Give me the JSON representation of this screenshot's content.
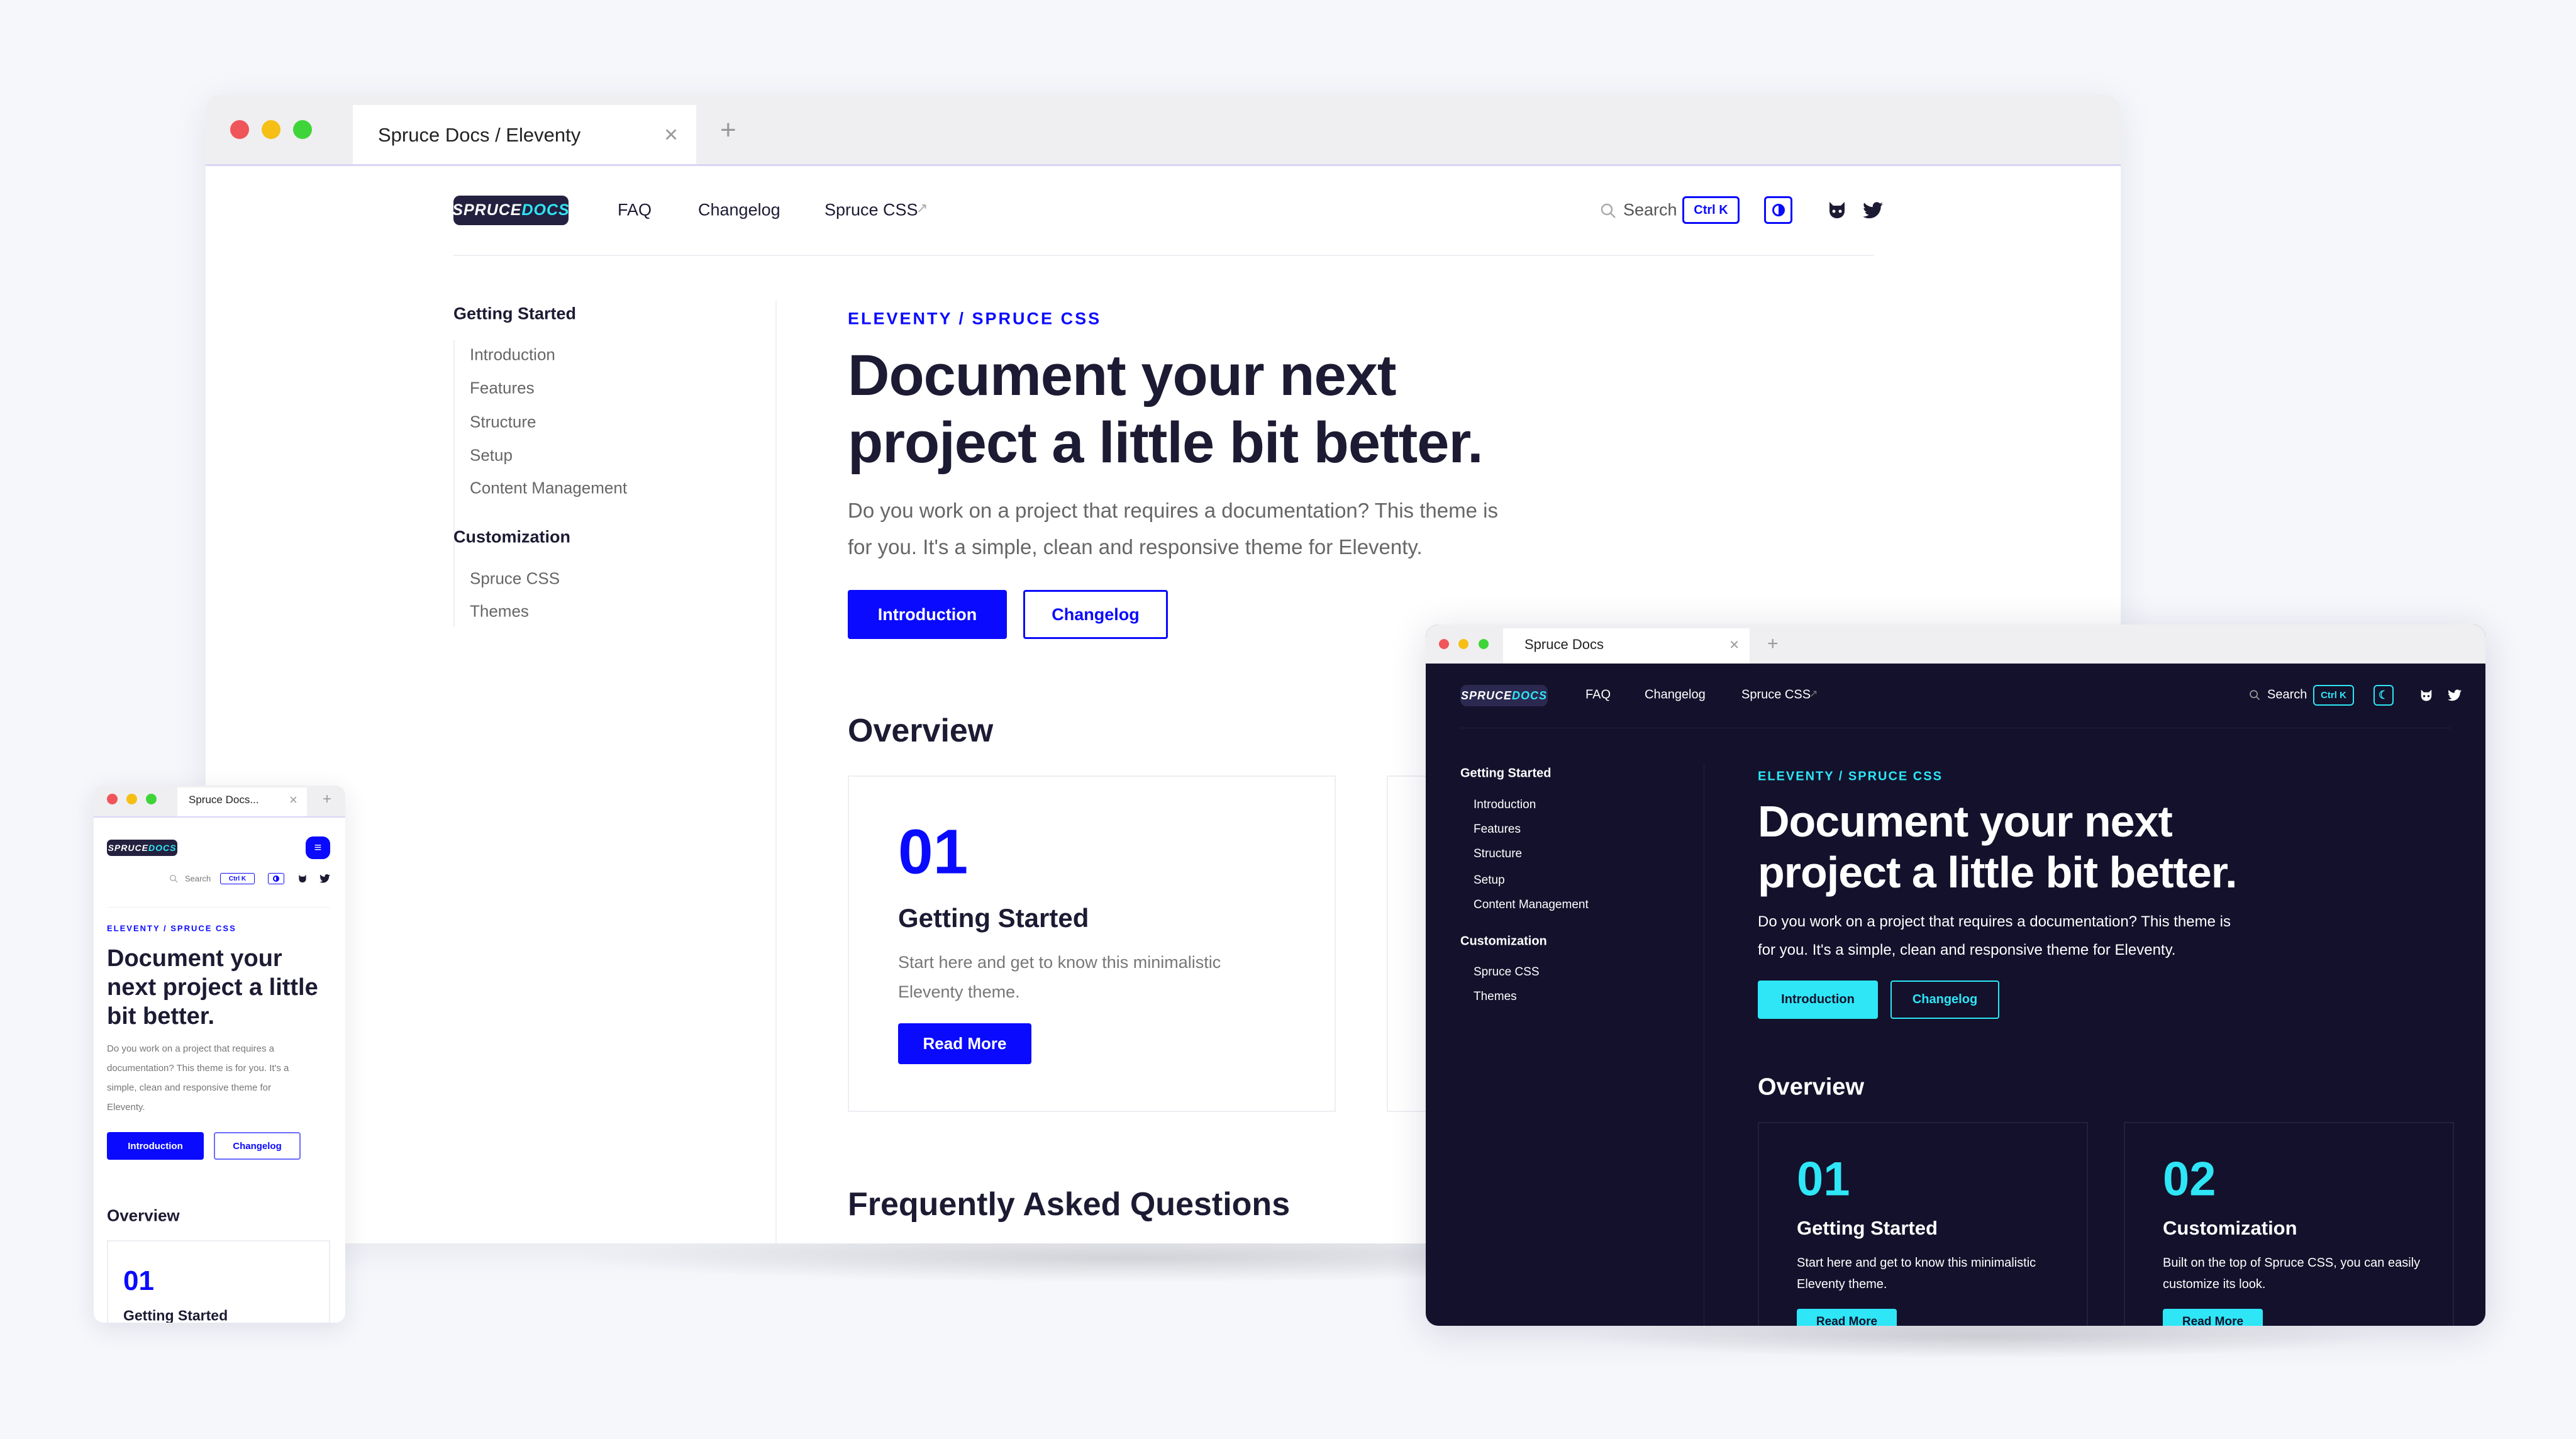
{
  "colors": {
    "accent_light": "#0a0aff",
    "accent_dark": "#2ee6f6",
    "dark_bg": "#13112b",
    "text": "#15142e"
  },
  "logo": {
    "part1": "SPRUCE",
    "part2": "DOCS"
  },
  "light": {
    "tab_title": "Spruce Docs / Eleventy",
    "nav": [
      "FAQ",
      "Changelog",
      "Spruce CSS"
    ],
    "search": "Search",
    "shortcut": "Ctrl K",
    "sidebar": [
      {
        "title": "Getting Started",
        "items": [
          "Introduction",
          "Features",
          "Structure",
          "Setup",
          "Content Management"
        ]
      },
      {
        "title": "Customization",
        "items": [
          "Spruce CSS",
          "Themes"
        ]
      }
    ],
    "eyebrow": "ELEVENTY / SPRUCE CSS",
    "heading": [
      "Document your next",
      "project a little bit better."
    ],
    "intro": [
      "Do you work on a project that requires a documentation? This theme is",
      "for you. It's a simple, clean and responsive theme for Eleventy."
    ],
    "buttons": {
      "primary": "Introduction",
      "secondary": "Changelog"
    },
    "overview": "Overview",
    "cards": [
      {
        "num": "01",
        "title": "Getting Started",
        "desc": [
          "Start here and get to know this minimalistic",
          "Eleventy theme."
        ],
        "cta": "Read More"
      }
    ],
    "faq": "Frequently Asked Questions"
  },
  "dark": {
    "tab_title": "Spruce Docs",
    "cards": [
      {
        "num": "01",
        "title": "Getting Started",
        "desc": [
          "Start here and get to know this minimalistic",
          "Eleventy theme."
        ],
        "cta": "Read More"
      },
      {
        "num": "02",
        "title": "Customization",
        "desc": [
          "Built on the top of Spruce CSS, you can easily",
          "customize its look."
        ],
        "cta": "Read More"
      }
    ]
  },
  "mobile": {
    "tab_title": "Spruce Docs...",
    "heading": [
      "Document your",
      "next project a little",
      "bit better."
    ],
    "intro": [
      "Do you work on a project that requires a",
      "documentation? This theme is for you. It's a",
      "simple, clean and responsive theme for",
      "Eleventy."
    ]
  }
}
